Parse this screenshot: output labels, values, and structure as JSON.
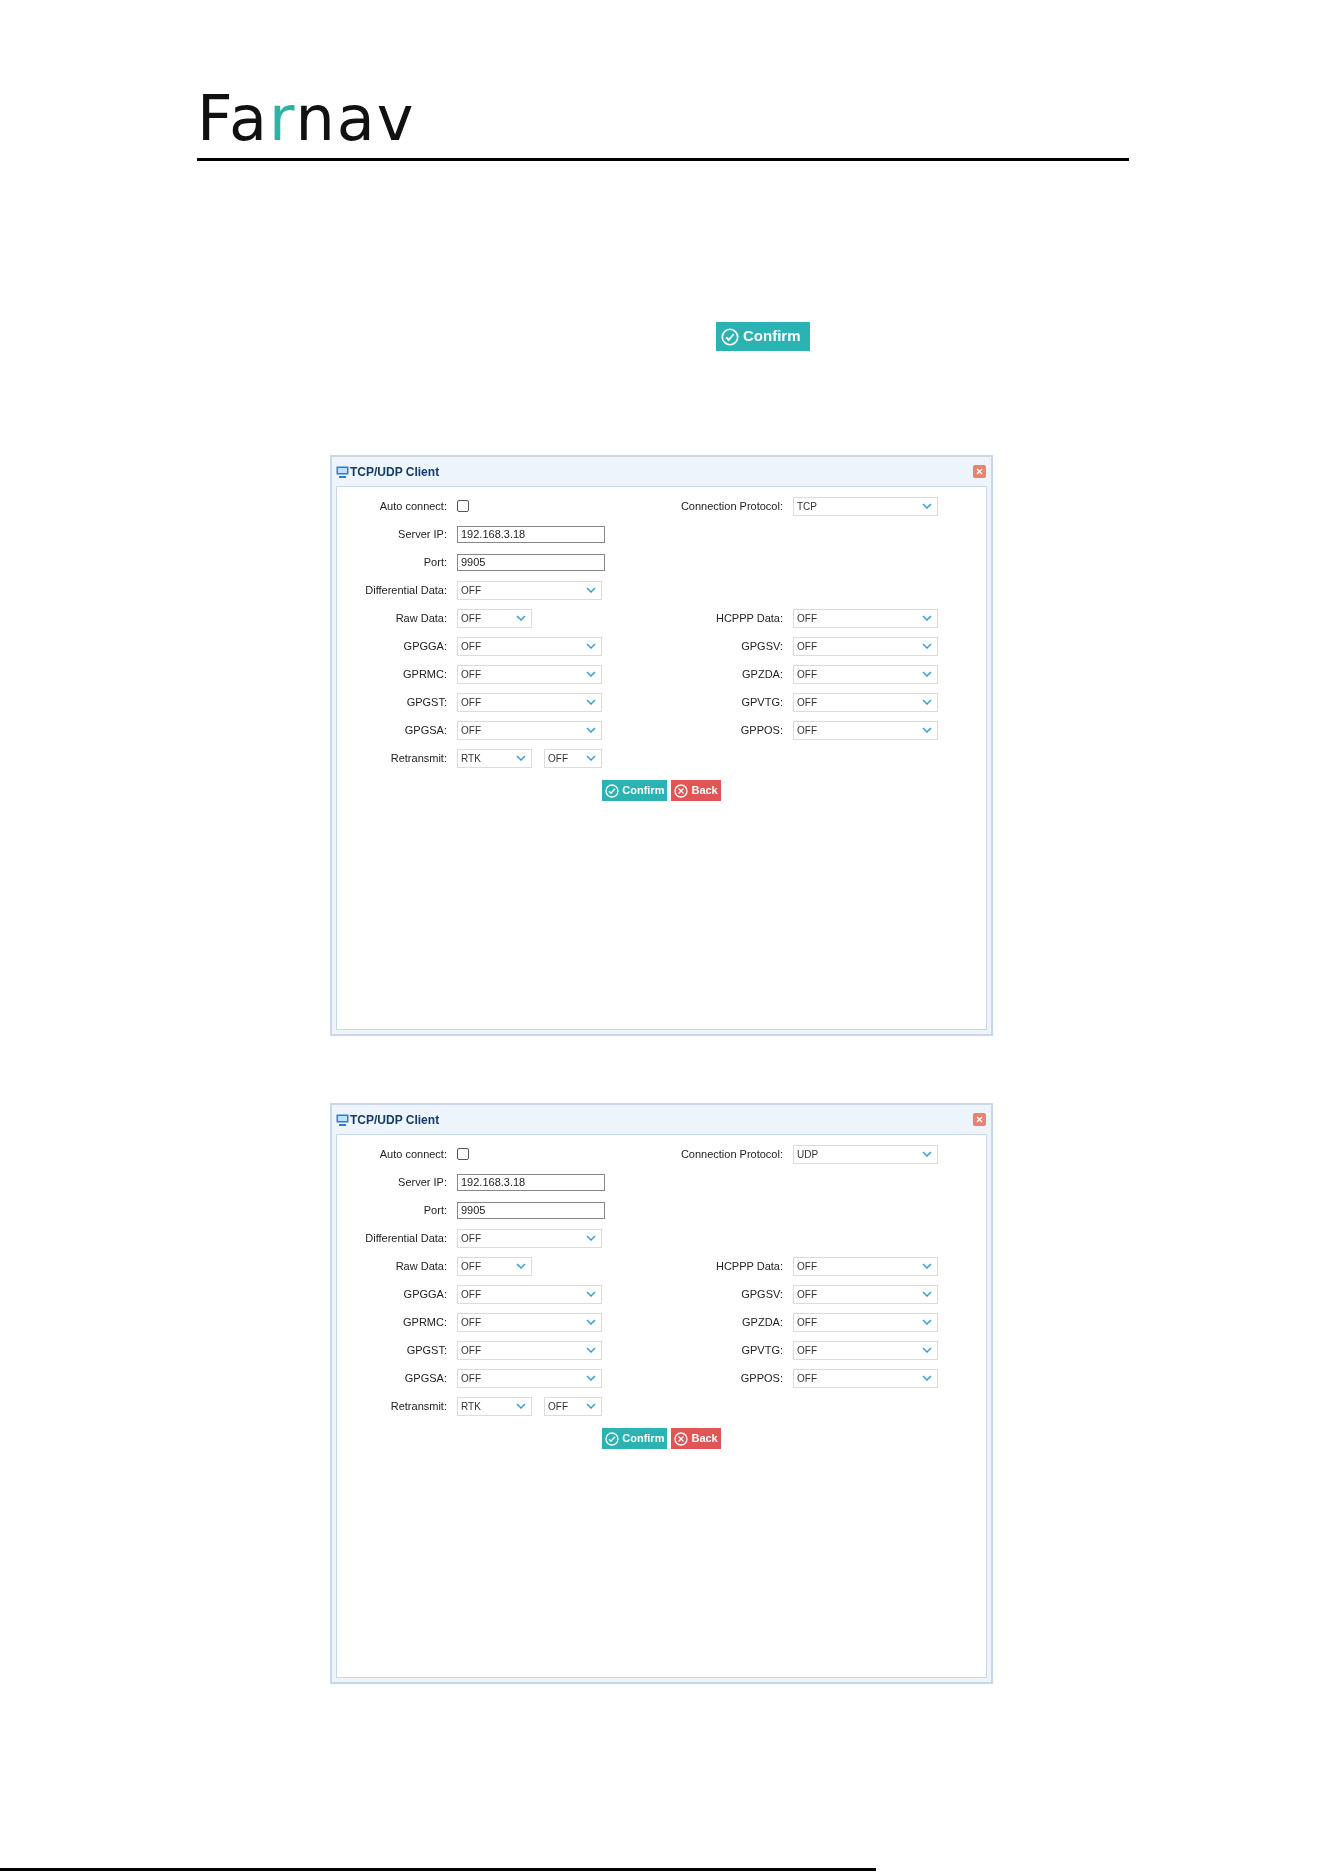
{
  "logo": {
    "segments": [
      {
        "text": "Fa",
        "accent": false
      },
      {
        "text": "r",
        "accent": true
      },
      {
        "text": "nav",
        "accent": false
      }
    ]
  },
  "inline_button": {
    "label": "Confirm"
  },
  "dialogs": [
    {
      "title": "TCP/UDP Client",
      "rows": [
        {
          "left": {
            "kind": "checkbox",
            "label": "Auto connect:",
            "checked": false
          },
          "right": {
            "kind": "select",
            "label": "Connection Protocol:",
            "value": "TCP"
          }
        },
        {
          "left": {
            "kind": "text",
            "label": "Server IP:",
            "value": "192.168.3.18"
          }
        },
        {
          "left": {
            "kind": "text",
            "label": "Port:",
            "value": "9905"
          }
        },
        {
          "left": {
            "kind": "select",
            "label": "Differential Data:",
            "value": "OFF"
          }
        },
        {
          "left": {
            "kind": "short_select",
            "label": "Raw Data:",
            "value": "OFF"
          },
          "right": {
            "kind": "select",
            "label": "HCPPP Data:",
            "value": "OFF"
          }
        },
        {
          "left": {
            "kind": "select",
            "label": "GPGGA:",
            "value": "OFF"
          },
          "right": {
            "kind": "select",
            "label": "GPGSV:",
            "value": "OFF"
          }
        },
        {
          "left": {
            "kind": "select",
            "label": "GPRMC:",
            "value": "OFF"
          },
          "right": {
            "kind": "select",
            "label": "GPZDA:",
            "value": "OFF"
          }
        },
        {
          "left": {
            "kind": "select",
            "label": "GPGST:",
            "value": "OFF"
          },
          "right": {
            "kind": "select",
            "label": "GPVTG:",
            "value": "OFF"
          }
        },
        {
          "left": {
            "kind": "select",
            "label": "GPGSA:",
            "value": "OFF"
          },
          "right": {
            "kind": "select",
            "label": "GPPOS:",
            "value": "OFF"
          }
        },
        {
          "left": {
            "kind": "pair_select",
            "label": "Retransmit:",
            "value": "RTK",
            "value_2": "OFF"
          }
        }
      ],
      "buttons": [
        {
          "kind": "confirm",
          "label": "Confirm"
        },
        {
          "kind": "back",
          "label": "Back"
        }
      ]
    },
    {
      "title": "TCP/UDP Client",
      "rows": [
        {
          "left": {
            "kind": "checkbox",
            "label": "Auto connect:",
            "checked": false
          },
          "right": {
            "kind": "select",
            "label": "Connection Protocol:",
            "value": "UDP"
          }
        },
        {
          "left": {
            "kind": "text",
            "label": "Server IP:",
            "value": "192.168.3.18"
          }
        },
        {
          "left": {
            "kind": "text",
            "label": "Port:",
            "value": "9905"
          }
        },
        {
          "left": {
            "kind": "select",
            "label": "Differential Data:",
            "value": "OFF"
          }
        },
        {
          "left": {
            "kind": "short_select",
            "label": "Raw Data:",
            "value": "OFF"
          },
          "right": {
            "kind": "select",
            "label": "HCPPP Data:",
            "value": "OFF"
          }
        },
        {
          "left": {
            "kind": "select",
            "label": "GPGGA:",
            "value": "OFF"
          },
          "right": {
            "kind": "select",
            "label": "GPGSV:",
            "value": "OFF"
          }
        },
        {
          "left": {
            "kind": "select",
            "label": "GPRMC:",
            "value": "OFF"
          },
          "right": {
            "kind": "select",
            "label": "GPZDA:",
            "value": "OFF"
          }
        },
        {
          "left": {
            "kind": "select",
            "label": "GPGST:",
            "value": "OFF"
          },
          "right": {
            "kind": "select",
            "label": "GPVTG:",
            "value": "OFF"
          }
        },
        {
          "left": {
            "kind": "select",
            "label": "GPGSA:",
            "value": "OFF"
          },
          "right": {
            "kind": "select",
            "label": "GPPOS:",
            "value": "OFF"
          }
        },
        {
          "left": {
            "kind": "pair_select",
            "label": "Retransmit:",
            "value": "RTK",
            "value_2": "OFF"
          }
        }
      ],
      "buttons": [
        {
          "kind": "confirm",
          "label": "Confirm"
        },
        {
          "kind": "back",
          "label": "Back"
        }
      ]
    }
  ]
}
